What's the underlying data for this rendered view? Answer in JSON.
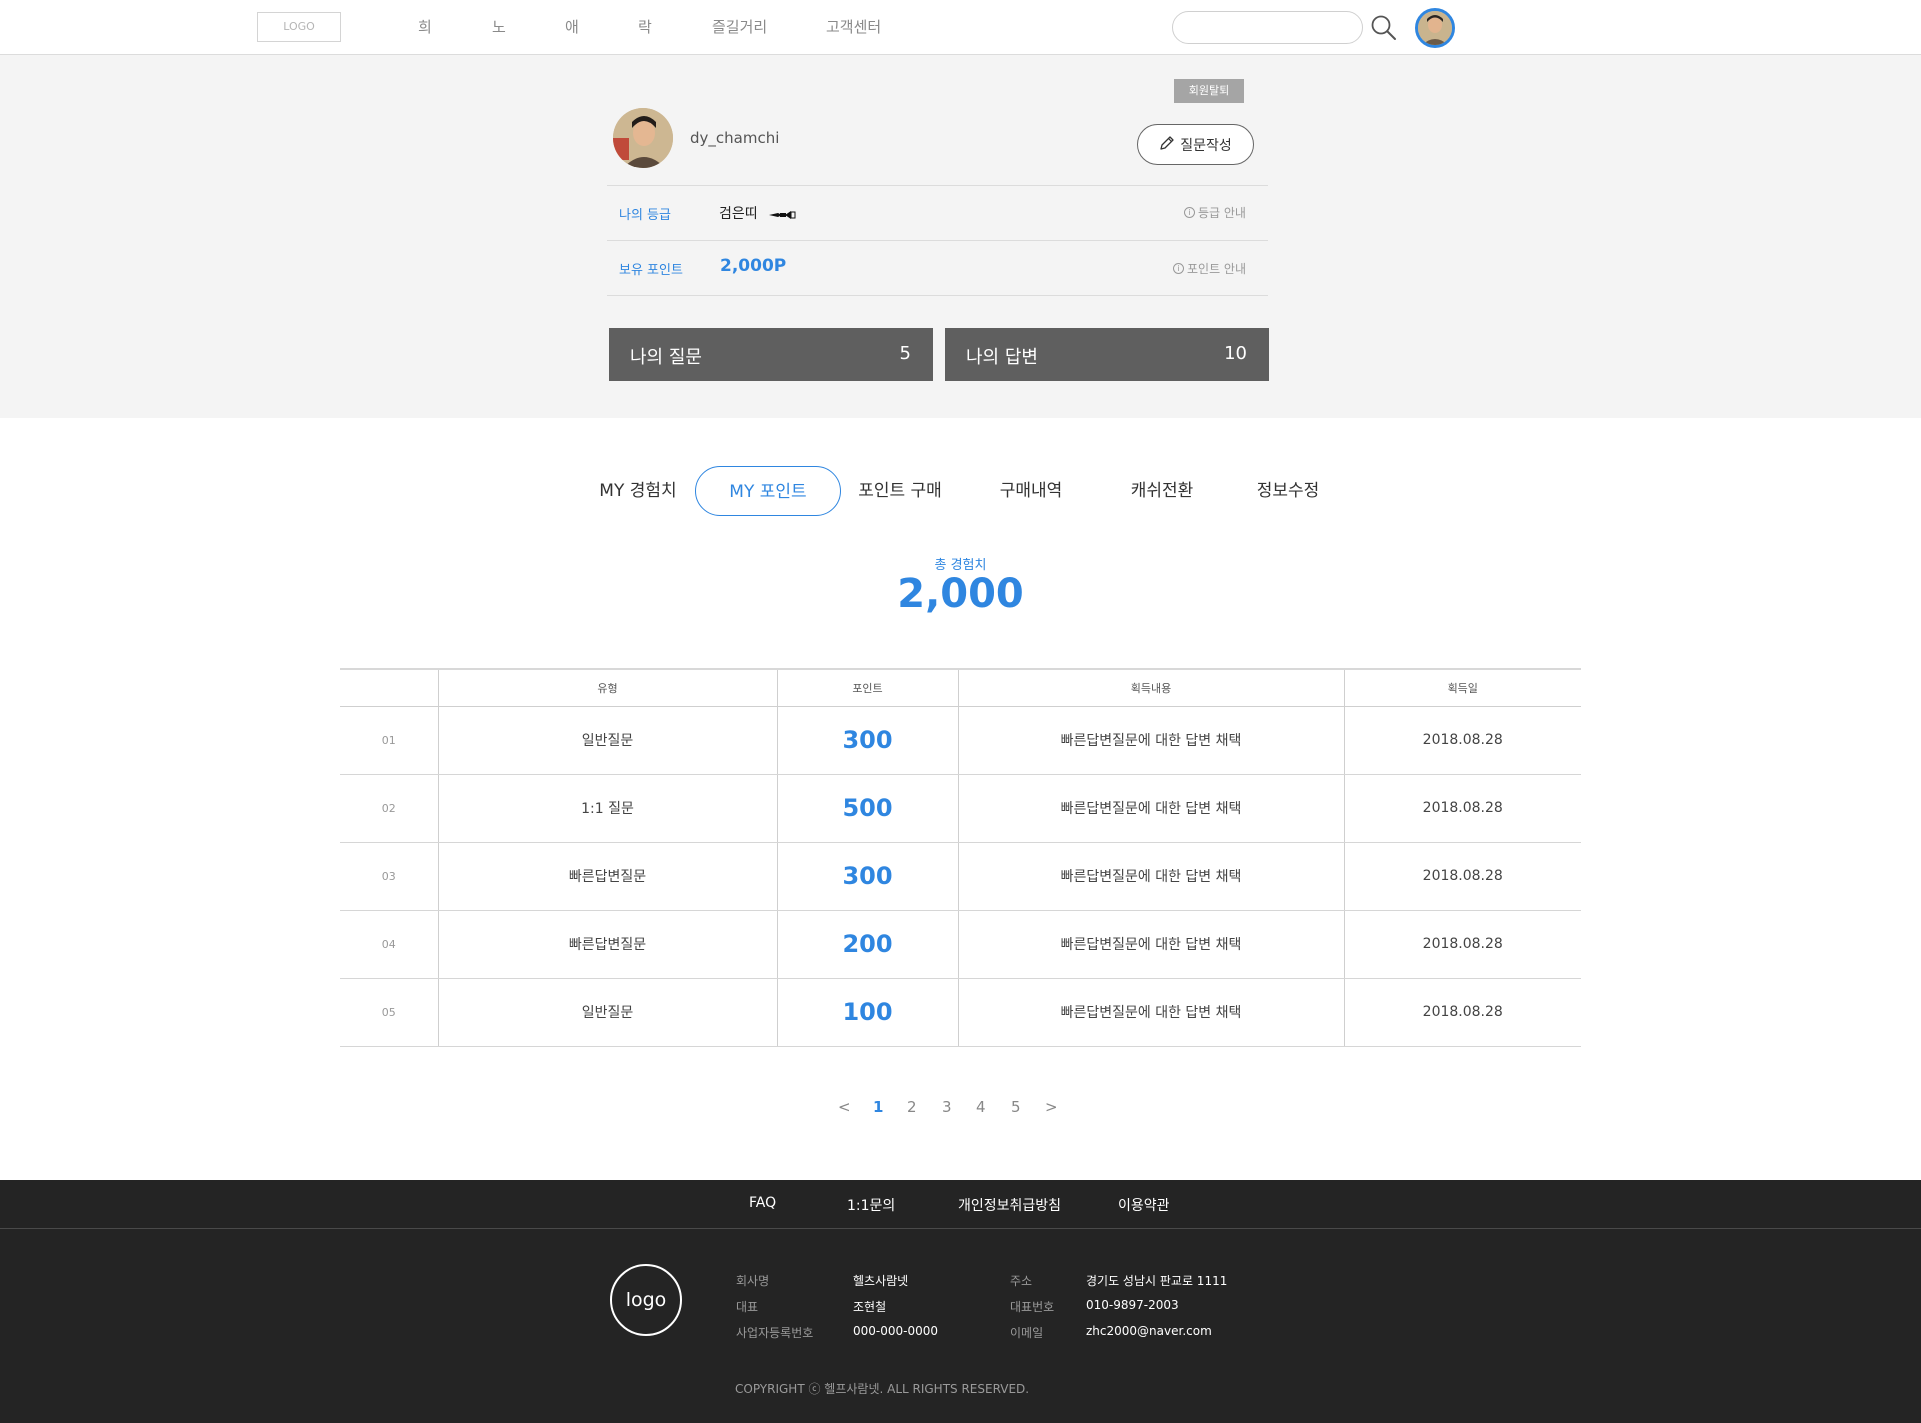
{
  "header": {
    "logo": "LOGO",
    "nav": [
      "희",
      "노",
      "애",
      "락",
      "즐길거리",
      "고객센터"
    ],
    "search_placeholder": ""
  },
  "profile": {
    "withdraw": "회원탈퇴",
    "username": "dy_chamchi",
    "write_question": "질문작성",
    "grade_label": "나의 등급",
    "grade_value": "검은띠",
    "grade_help": "등급 안내",
    "points_label": "보유 포인트",
    "points_value": "2,000P",
    "points_help": "포인트 안내",
    "my_questions_label": "나의 질문",
    "my_questions_count": "5",
    "my_answers_label": "나의 답변",
    "my_answers_count": "10"
  },
  "tabs": [
    "MY 경험치",
    "MY 포인트",
    "포인트 구매",
    "구매내역",
    "캐쉬전환",
    "정보수정"
  ],
  "active_tab": "MY 포인트",
  "total": {
    "label": "총 경험치",
    "value": "2,000"
  },
  "table": {
    "headers": [
      "",
      "유형",
      "포인트",
      "획득내용",
      "획득일"
    ],
    "rows": [
      {
        "no": "01",
        "type": "일반질문",
        "points": "300",
        "content": "빠른답변질문에 대한 답변 채택",
        "date": "2018.08.28"
      },
      {
        "no": "02",
        "type": "1:1 질문",
        "points": "500",
        "content": "빠른답변질문에 대한 답변 채택",
        "date": "2018.08.28"
      },
      {
        "no": "03",
        "type": "빠른답변질문",
        "points": "300",
        "content": "빠른답변질문에 대한 답변 채택",
        "date": "2018.08.28"
      },
      {
        "no": "04",
        "type": "빠른답변질문",
        "points": "200",
        "content": "빠른답변질문에 대한 답변 채택",
        "date": "2018.08.28"
      },
      {
        "no": "05",
        "type": "일반질문",
        "points": "100",
        "content": "빠른답변질문에 대한 답변 채택",
        "date": "2018.08.28"
      }
    ]
  },
  "pagination": {
    "prev": "<",
    "pages": [
      "1",
      "2",
      "3",
      "4",
      "5"
    ],
    "current": "1",
    "next": ">"
  },
  "footer": {
    "links": [
      "FAQ",
      "1:1문의",
      "개인정보취급방침",
      "이용약관"
    ],
    "logo": "logo",
    "company_label": "회사명",
    "company_value": "헬츠사람넷",
    "ceo_label": "대표",
    "ceo_value": "조현철",
    "bizno_label": "사업자등록번호",
    "bizno_value": "000-000-0000",
    "address_label": "주소",
    "address_value": "경기도 성남시 판교로 1111",
    "phone_label": "대표번호",
    "phone_value": "010-9897-2003",
    "email_label": "이메일",
    "email_value": "zhc2000@naver.com",
    "copyright": "COPYRIGHT ⓒ 헬프사람넷. ALL RIGHTS RESERVED."
  },
  "colors": {
    "accent": "#2f86e0",
    "stat_box": "#5f5f5f",
    "footer_bg": "#242424",
    "band_bg": "#f4f4f4"
  },
  "icons": [
    "search-icon",
    "pencil-icon",
    "info-icon",
    "black-belt-icon",
    "avatar"
  ]
}
